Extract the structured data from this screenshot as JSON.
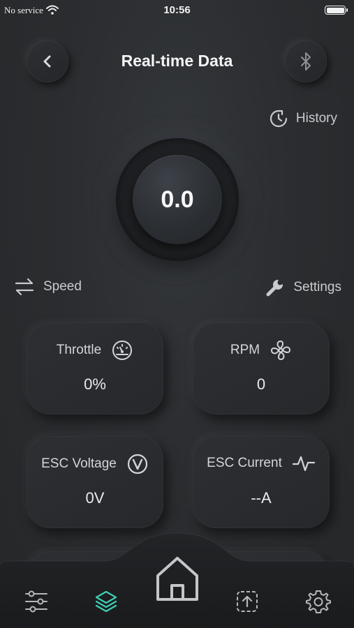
{
  "status_bar": {
    "carrier": "No service",
    "time": "10:56"
  },
  "header": {
    "title": "Real-time Data",
    "back_icon": "chevron-left-icon",
    "bluetooth_icon": "bluetooth-icon"
  },
  "history": {
    "label": "History",
    "icon": "history-clock-icon"
  },
  "gauge": {
    "value": "0.0"
  },
  "mode": {
    "speed_label": "Speed",
    "settings_label": "Settings"
  },
  "cards": {
    "throttle": {
      "label": "Throttle",
      "value": "0%",
      "icon": "speedometer-icon"
    },
    "rpm": {
      "label": "RPM",
      "value": "0",
      "icon": "fan-icon"
    },
    "esc_voltage": {
      "label": "ESC Voltage",
      "value": "0V",
      "icon": "voltage-icon"
    },
    "esc_current": {
      "label": "ESC Current",
      "value": "--A",
      "icon": "pulse-icon"
    }
  },
  "tab_bar": {
    "items": [
      "sliders-icon",
      "layers-icon",
      "home-icon",
      "upload-icon",
      "gear-icon"
    ],
    "active": "layers-icon",
    "accent": "#3fd0b4"
  },
  "colors": {
    "background": "#2a2c2f",
    "text": "#e6e8ea",
    "muted": "#c9cbce",
    "accent": "#3fd0b4"
  }
}
